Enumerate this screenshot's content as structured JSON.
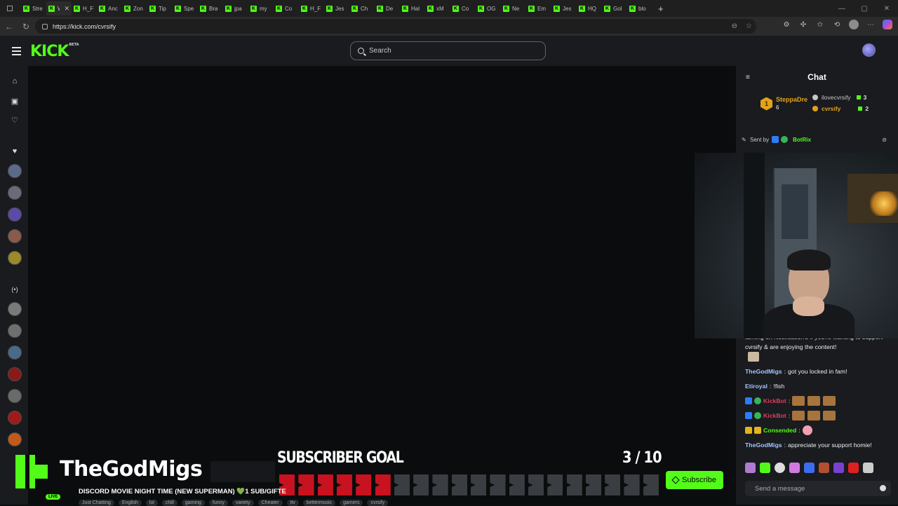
{
  "browser": {
    "tabs": [
      {
        "title": "Stre",
        "active": false
      },
      {
        "title": "Wh",
        "active": true
      },
      {
        "title": "H_F",
        "active": false
      },
      {
        "title": "Anc",
        "active": false
      },
      {
        "title": "Zon",
        "active": false
      },
      {
        "title": "Tip",
        "active": false
      },
      {
        "title": "Spe",
        "active": false
      },
      {
        "title": "Bra",
        "active": false
      },
      {
        "title": "jpa",
        "active": false
      },
      {
        "title": "my",
        "active": false
      },
      {
        "title": "Co",
        "active": false
      },
      {
        "title": "H_F",
        "active": false
      },
      {
        "title": "Jes",
        "active": false
      },
      {
        "title": "Ch",
        "active": false
      },
      {
        "title": "De",
        "active": false
      },
      {
        "title": "Hal",
        "active": false
      },
      {
        "title": "xM",
        "active": false
      },
      {
        "title": "Co",
        "active": false
      },
      {
        "title": "OG",
        "active": false
      },
      {
        "title": "Ne",
        "active": false
      },
      {
        "title": "Em",
        "active": false
      },
      {
        "title": "Jes",
        "active": false
      },
      {
        "title": "HQ",
        "active": false
      },
      {
        "title": "Gol",
        "active": false
      },
      {
        "title": "blo",
        "active": false
      }
    ],
    "url": "https://kick.com/cvrsify"
  },
  "site": {
    "logo": "KICK",
    "logo_tag": "BETA",
    "search_placeholder": "Search"
  },
  "chat": {
    "title": "Chat",
    "leaderboard": {
      "top": {
        "rank": "1",
        "name": "SteppaDre",
        "count": "6"
      },
      "rows": [
        {
          "name": "ilovecvrsify",
          "count": "3",
          "color": "#c7c7c7"
        },
        {
          "name": "cvrsify",
          "count": "2",
          "color": "#e3a21a"
        }
      ]
    },
    "pinned": {
      "label": "Sent by",
      "sender": "BotRix"
    },
    "partial_message": "turning on Notification's if you're wanting to support cvrsify & are enjoying the content!",
    "messages": [
      {
        "user": "TheGodMigs",
        "color": "blue",
        "text": "got you locked in fam!",
        "emotes": 0,
        "badges": []
      },
      {
        "user": "Etiroyal",
        "color": "blue",
        "text": "!fish",
        "emotes": 0,
        "badges": []
      },
      {
        "user": "KickBot",
        "color": "red",
        "text": "",
        "emotes": 3,
        "badges": [
          "b",
          "g"
        ]
      },
      {
        "user": "KickBot",
        "color": "red",
        "text": "",
        "emotes": 3,
        "badges": [
          "b",
          "g"
        ]
      },
      {
        "user": "Consended",
        "color": "green",
        "text": "",
        "emotes": 1,
        "badges": [
          "y",
          "y"
        ]
      },
      {
        "user": "TheGodMigs",
        "color": "blue",
        "text": "appreciate your support homie!",
        "emotes": 0,
        "badges": []
      }
    ],
    "input_placeholder": "Send a message"
  },
  "overlay": {
    "streamer": "TheGodMigs",
    "goal_title": "SUBSCRIBER GOAL",
    "goal_count": "3 / 10",
    "goal_current": 3,
    "goal_total": 10,
    "goal_segments_red": 6,
    "goal_segments_total": 20,
    "ticker": "DISCORD MOVIE NIGHT TIME (NEW SUPERMAN) 💚1 SUB/GIFTE",
    "live": "LIVE",
    "tags": [
      "Just Chatting",
      "English",
      "lol",
      "chill",
      "gaming",
      "funny",
      "variety",
      "Cheater",
      "ttv",
      "bettermusic",
      "gamers",
      "cvrsify"
    ]
  },
  "stream": {
    "subscribe_label": "Subscribe"
  },
  "colors": {
    "brand": "#53fc18",
    "bg": "#0b0e0f",
    "panel": "#191b1f",
    "goal_red": "#c9121f",
    "goal_grey": "#3a3d41"
  }
}
